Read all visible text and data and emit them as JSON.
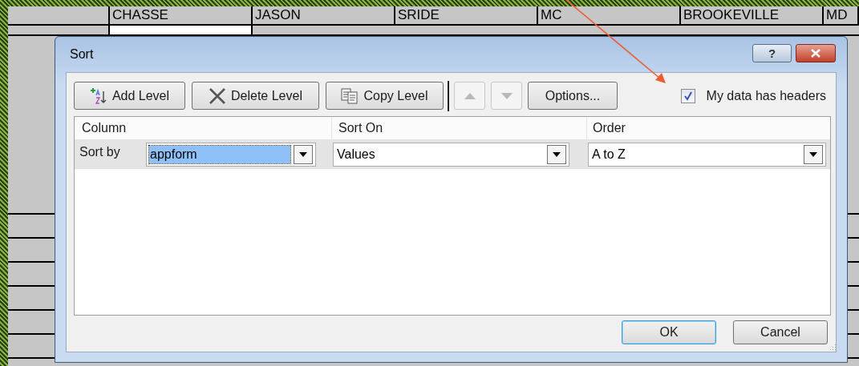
{
  "sheet": {
    "column_headers": [
      "CHASSE",
      "JASON",
      "SRIDE",
      "MC",
      "BROOKEVILLE",
      "MD"
    ]
  },
  "dialog": {
    "title": "Sort",
    "help_button": "?",
    "toolbar": [
      {
        "kind": "add",
        "label": "Add Level",
        "disabled": false
      },
      {
        "kind": "delete",
        "label": "Delete Level",
        "disabled": false
      },
      {
        "kind": "copy",
        "label": "Copy Level",
        "disabled": false
      },
      {
        "kind": "move_up",
        "disabled": true
      },
      {
        "kind": "move_down",
        "disabled": true
      },
      {
        "kind": "options",
        "label": "Options...",
        "disabled": false
      }
    ],
    "headers_checkbox": {
      "label": "My data has headers",
      "checked": true
    },
    "columns": [
      "Column",
      "Sort On",
      "Order"
    ],
    "levels": [
      {
        "label": "Sort by",
        "column": "appform",
        "sort_on": "Values",
        "order": "A to Z",
        "selected": true
      }
    ],
    "buttons": [
      {
        "label": "OK",
        "default": true
      },
      {
        "label": "Cancel",
        "default": false
      }
    ]
  }
}
